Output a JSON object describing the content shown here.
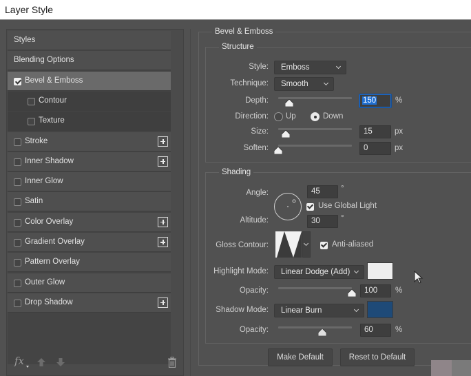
{
  "window": {
    "title": "Layer Style"
  },
  "sidebar": {
    "items": [
      {
        "label": "Styles",
        "checkbox": false,
        "checked": false,
        "plus": false,
        "selected": false,
        "sub": false
      },
      {
        "label": "Blending Options",
        "checkbox": false,
        "checked": false,
        "plus": false,
        "selected": false,
        "sub": false
      },
      {
        "label": "Bevel & Emboss",
        "checkbox": true,
        "checked": true,
        "plus": false,
        "selected": true,
        "sub": false
      },
      {
        "label": "Contour",
        "checkbox": true,
        "checked": false,
        "plus": false,
        "selected": false,
        "sub": true
      },
      {
        "label": "Texture",
        "checkbox": true,
        "checked": false,
        "plus": false,
        "selected": false,
        "sub": true
      },
      {
        "label": "Stroke",
        "checkbox": true,
        "checked": false,
        "plus": true,
        "selected": false,
        "sub": false
      },
      {
        "label": "Inner Shadow",
        "checkbox": true,
        "checked": false,
        "plus": true,
        "selected": false,
        "sub": false
      },
      {
        "label": "Inner Glow",
        "checkbox": true,
        "checked": false,
        "plus": false,
        "selected": false,
        "sub": false
      },
      {
        "label": "Satin",
        "checkbox": true,
        "checked": false,
        "plus": false,
        "selected": false,
        "sub": false
      },
      {
        "label": "Color Overlay",
        "checkbox": true,
        "checked": false,
        "plus": true,
        "selected": false,
        "sub": false
      },
      {
        "label": "Gradient Overlay",
        "checkbox": true,
        "checked": false,
        "plus": true,
        "selected": false,
        "sub": false
      },
      {
        "label": "Pattern Overlay",
        "checkbox": true,
        "checked": false,
        "plus": false,
        "selected": false,
        "sub": false
      },
      {
        "label": "Outer Glow",
        "checkbox": true,
        "checked": false,
        "plus": false,
        "selected": false,
        "sub": false
      },
      {
        "label": "Drop Shadow",
        "checkbox": true,
        "checked": false,
        "plus": true,
        "selected": false,
        "sub": false
      }
    ],
    "footer": {
      "fx_label": "fx",
      "icons": [
        "move-up-icon",
        "move-down-icon",
        "trash-icon"
      ]
    }
  },
  "bevel": {
    "title": "Bevel & Emboss",
    "structure": {
      "title": "Structure",
      "style": {
        "label": "Style:",
        "value": "Emboss"
      },
      "technique": {
        "label": "Technique:",
        "value": "Smooth"
      },
      "depth": {
        "label": "Depth:",
        "value": "150",
        "unit": "%",
        "slider_fraction": 0.15
      },
      "direction": {
        "label": "Direction:",
        "options": [
          "Up",
          "Down"
        ],
        "selected": "Down"
      },
      "size": {
        "label": "Size:",
        "value": "15",
        "unit": "px",
        "slider_fraction": 0.1
      },
      "soften": {
        "label": "Soften:",
        "value": "0",
        "unit": "px",
        "slider_fraction": 0.0
      }
    },
    "shading": {
      "title": "Shading",
      "angle": {
        "label": "Angle:",
        "value": "45",
        "unit": "°"
      },
      "use_global_light": {
        "label": "Use Global Light",
        "checked": true
      },
      "altitude": {
        "label": "Altitude:",
        "value": "30",
        "unit": "°"
      },
      "gloss_contour": {
        "label": "Gloss Contour:"
      },
      "anti_aliased": {
        "label": "Anti-aliased",
        "checked": true
      },
      "highlight_mode": {
        "label": "Highlight Mode:",
        "value": "Linear Dodge (Add)",
        "color": "#eeeeee"
      },
      "highlight_opacity": {
        "label": "Opacity:",
        "value": "100",
        "unit": "%",
        "slider_fraction": 1.0
      },
      "shadow_mode": {
        "label": "Shadow Mode:",
        "value": "Linear Burn",
        "color": "#1e4a78"
      },
      "shadow_opacity": {
        "label": "Opacity:",
        "value": "60",
        "unit": "%",
        "slider_fraction": 0.6
      }
    },
    "buttons": {
      "make_default": "Make Default",
      "reset_default": "Reset to Default"
    }
  }
}
